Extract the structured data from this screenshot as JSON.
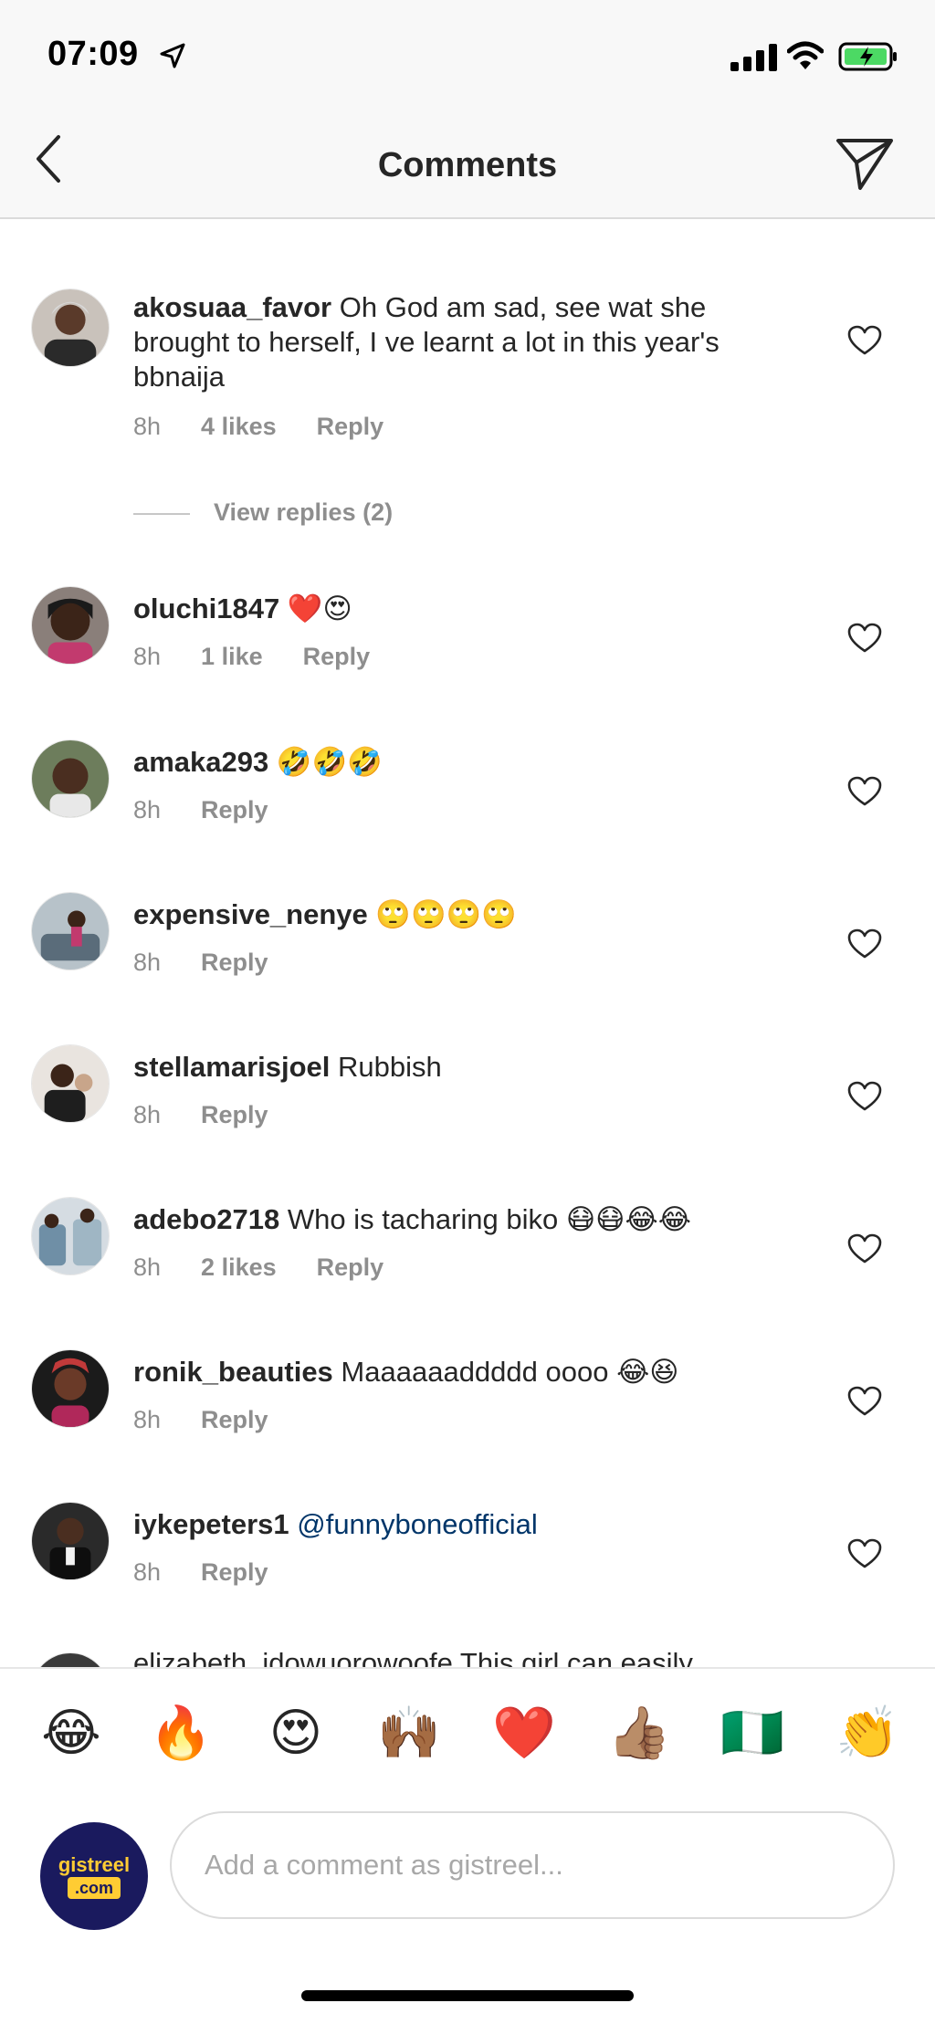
{
  "status_bar": {
    "time": "07:09"
  },
  "header": {
    "title": "Comments"
  },
  "comments": [
    {
      "user": "akosuaa_favor",
      "text": " Oh God am sad, see wat she brought to herself, I ve learnt a lot in this year's bbnaija",
      "time": "8h",
      "likes": "4 likes",
      "reply": "Reply"
    },
    {
      "user": "oluchi1847",
      "text": " ❤️😍",
      "time": "8h",
      "likes": "1 like",
      "reply": "Reply"
    },
    {
      "user": "amaka293",
      "text": " 🤣🤣🤣",
      "time": "8h",
      "reply": "Reply"
    },
    {
      "user": "expensive_nenye",
      "text": " 🙄🙄🙄🙄",
      "time": "8h",
      "reply": "Reply"
    },
    {
      "user": "stellamarisjoel",
      "text": " Rubbish",
      "time": "8h",
      "reply": "Reply"
    },
    {
      "user": "adebo2718",
      "text": " Who is tacharing biko 😷😷😂😂",
      "time": "8h",
      "likes": "2 likes",
      "reply": "Reply"
    },
    {
      "user": "ronik_beauties",
      "text": " Maaaaaaddddd oooo 😂😆",
      "time": "8h",
      "reply": "Reply"
    },
    {
      "user": "iykepeters1",
      "mention": " @funnyboneofficial",
      "time": "8h",
      "reply": "Reply"
    }
  ],
  "view_replies": "View replies (2)",
  "cut_comment": "elizabeth_idowuorowoofe This girl can easily",
  "emoji_bar": [
    "😂",
    "🔥",
    "😍",
    "🙌🏾",
    "❤️",
    "👍🏽",
    "🇳🇬",
    "👏"
  ],
  "composer": {
    "avatar_line1": "gistreel",
    "avatar_line2": ".com",
    "placeholder": "Add a comment as gistreel..."
  },
  "colors": {
    "mention": "#003569",
    "meta": "#8e8e8e",
    "avatar_bg": "#1a1a5e",
    "avatar_fg": "#ffcc33"
  }
}
